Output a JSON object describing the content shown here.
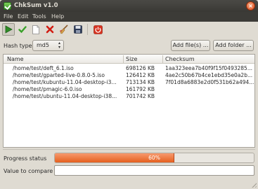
{
  "window": {
    "title": "ChkSum v1.0",
    "close_glyph": "×"
  },
  "menu": [
    "File",
    "Edit",
    "Tools",
    "Help"
  ],
  "toolbar": {
    "icons": [
      "play-icon",
      "check-icon",
      "new-document-icon",
      "delete-x-icon",
      "clear-broom-icon",
      "save-disk-icon",
      "power-icon"
    ]
  },
  "hash": {
    "label": "Hash type",
    "selected": "md5"
  },
  "buttons": {
    "add_files": "Add file(s) ...",
    "add_folder": "Add folder ..."
  },
  "table": {
    "headers": [
      "Name",
      "Size",
      "Checksum"
    ],
    "rows": [
      {
        "name": "/home/test/deft_6.1.iso",
        "size": "698126 KB",
        "checksum": "1aa323eea7b40f9f15f0493285..."
      },
      {
        "name": "/home/test/gparted-live-0.8.0-5.iso",
        "size": "126412 KB",
        "checksum": "4ae2c50b67b4ce1ebd35e0a2b..."
      },
      {
        "name": "/home/test/kubuntu-11.04-desktop-i3...",
        "size": "713134 KB",
        "checksum": "7f01d8a6883e2d0f531b62a494..."
      },
      {
        "name": "/home/test/pmagic-6.0.iso",
        "size": "161792 KB",
        "checksum": ""
      },
      {
        "name": "/home/test/ubuntu-11.04-desktop-i38...",
        "size": "701742 KB",
        "checksum": ""
      }
    ]
  },
  "progress": {
    "label": "Progress status",
    "value": 60,
    "text": "60%"
  },
  "compare": {
    "label": "Value to compare",
    "value": ""
  },
  "colors": {
    "progress": "#e5601f",
    "titlebar": "#3c3b37",
    "window_bg": "#dfdbd2"
  }
}
